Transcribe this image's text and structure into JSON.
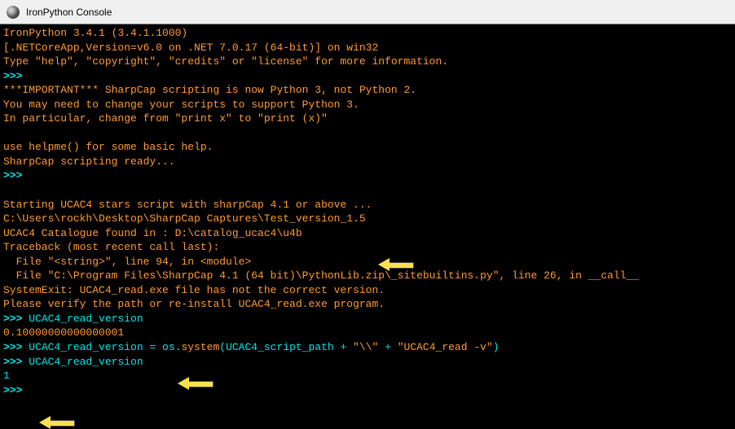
{
  "window": {
    "title": "IronPython Console"
  },
  "lines": {
    "l1": "IronPython 3.4.1 (3.4.1.1000)",
    "l2": "[.NETCoreApp,Version=v6.0 on .NET 7.0.17 (64-bit)] on win32",
    "l3": "Type \"help\", \"copyright\", \"credits\" or \"license\" for more information.",
    "p1": ">>>",
    "l4": "***IMPORTANT*** SharpCap scripting is now Python 3, not Python 2.",
    "l5": "You may need to change your scripts to support Python 3.",
    "l6": "In particular, change from \"print x\" to \"print (x)\"",
    "blank": " ",
    "l7": "use helpme() for some basic help.",
    "l8": "SharpCap scripting ready...",
    "p2": ">>>",
    "l9": "Starting UCAC4 stars script with sharpCap 4.1 or above ...",
    "l10": "C:\\Users\\rockh\\Desktop\\SharpCap Captures\\Test_version_1.5",
    "l11": "UCAC4 Catalogue found in : D:\\catalog_ucac4\\u4b",
    "l12": "Traceback (most recent call last):",
    "l13": "  File \"<string>\", line 94, in <module>",
    "l14": "  File \"C:\\Program Files\\SharpCap 4.1 (64 bit)\\PythonLib.zip\\_sitebuiltins.py\", line 26, in __call__",
    "l15": "SystemExit: UCAC4_read.exe file has not the correct version.",
    "l16": "Please verify the path or re-install UCAC4_read.exe program.",
    "p3": ">>> ",
    "l17": "UCAC4_read_version",
    "l18": "0.10000000000000001",
    "p4": ">>> ",
    "l19a": "UCAC4_read_version = os.",
    "l19b": "system",
    "l19c": "(UCAC4_script_path + ",
    "l19d": "\"\\\\\"",
    "l19e": " + ",
    "l19f": "\"UCAC4_read -v\"",
    "l19g": ")",
    "p5": ">>> ",
    "l20": "UCAC4_read_version",
    "l21": "1",
    "p6": ">>> "
  }
}
